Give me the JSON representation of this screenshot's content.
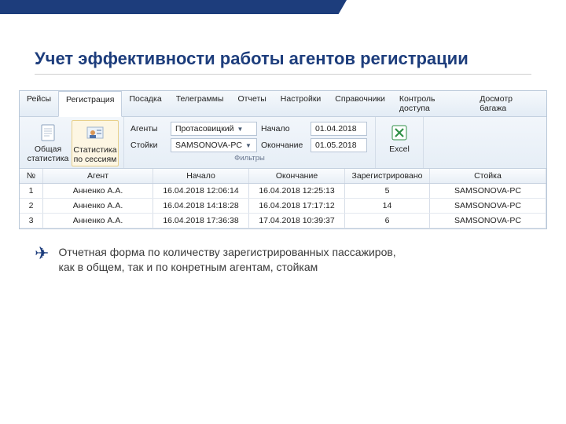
{
  "title": "Учет эффективности работы агентов регистрации",
  "menu": [
    "Рейсы",
    "Регистрация",
    "Посадка",
    "Телеграммы",
    "Отчеты",
    "Настройки",
    "Справочники",
    "Контроль доступа",
    "Досмотр багажа"
  ],
  "active_menu_index": 1,
  "ribbon": {
    "stats_btn": "Общая\nстатистика",
    "sessions_btn": "Статистика\nпо сессиям",
    "filters_caption": "Фильтры",
    "agents_label": "Агенты",
    "agents_value": "Протасовицкий",
    "stands_label": "Стойки",
    "stands_value": "SAMSONOVA-PC",
    "start_label": "Начало",
    "start_value": "01.04.2018",
    "end_label": "Окончание",
    "end_value": "01.05.2018",
    "excel_btn": "Excel"
  },
  "columns": [
    "№",
    "Агент",
    "Начало",
    "Окончание",
    "Зарегистрировано",
    "Стойка"
  ],
  "rows": [
    {
      "n": "1",
      "agent": "Анненко А.А.",
      "start": "16.04.2018 12:06:14",
      "end": "16.04.2018 12:25:13",
      "reg": "5",
      "stand": "SAMSONOVA-PC"
    },
    {
      "n": "2",
      "agent": "Анненко А.А.",
      "start": "16.04.2018 14:18:28",
      "end": "16.04.2018 17:17:12",
      "reg": "14",
      "stand": "SAMSONOVA-PC"
    },
    {
      "n": "3",
      "agent": "Анненко А.А.",
      "start": "16.04.2018 17:36:38",
      "end": "17.04.2018 10:39:37",
      "reg": "6",
      "stand": "SAMSONOVA-PC"
    }
  ],
  "note": "Отчетная форма по количеству зарегистрированных пассажиров, как в общем, так и по конретным агентам, стойкам"
}
